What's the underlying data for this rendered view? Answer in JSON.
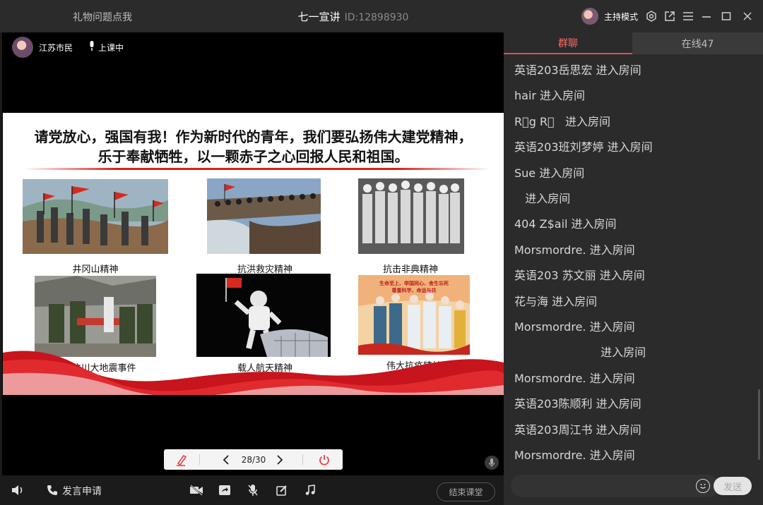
{
  "titlebar": {
    "left_title": "礼物问题点我",
    "room_name": "七一宣讲",
    "room_id": "ID:12898930",
    "host_mode": "主持模式",
    "icons": [
      "settings-icon",
      "popout-icon",
      "menu-icon",
      "minimize-icon",
      "maximize-icon",
      "close-icon"
    ]
  },
  "presenter": {
    "name": "江苏市民",
    "status": "上课中"
  },
  "slide": {
    "heading_line1": "请党放心，强国有我！作为新时代的青年，我们要弘扬伟大建党精神，",
    "heading_line2": "乐于奉献牺牲，以一颗赤子之心回报人民和祖国。",
    "captions": [
      "井冈山精神",
      "抗洪救灾精神",
      "抗击非典精神",
      "四川汶川大地震事件",
      "载人航天精神",
      "伟大抗疫精神"
    ],
    "poster_text_1": "生命至上、举国同心、舍生忘死",
    "poster_text_2": "尊重科学、命运与共"
  },
  "slide_controls": {
    "page": "28/30"
  },
  "bottombar": {
    "apply_speak": "发言申请",
    "end_class": "结束课堂"
  },
  "sidepanel": {
    "tab_chat": "群聊",
    "tab_online": "在线47",
    "messages": [
      "英语203岳思宏 进入房间",
      "hair 进入房间",
      "R⃢g R⃢   进入房间",
      "英语203班刘梦婷 进入房间",
      "Sue 进入房间",
      "   进入房间",
      "404 Z$ail 进入房间",
      "Morsmordre. 进入房间",
      "英语203 苏文丽 进入房间",
      "花与海 进入房间",
      "Morsmordre. 进入房间",
      "                        进入房间",
      "Morsmordre. 进入房间",
      "英语203陈顺利 进入房间",
      "英语203周江书 进入房间",
      "Morsmordre. 进入房间"
    ],
    "composer_placeholder": "",
    "send_label": "发送"
  },
  "colors": {
    "accent_red": "#e05050",
    "panel_bg": "#2b2b2b",
    "slide_red": "#d81e1e"
  }
}
